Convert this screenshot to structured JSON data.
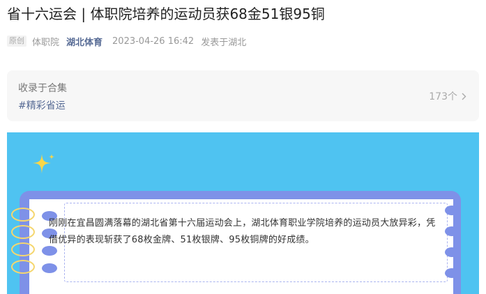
{
  "article": {
    "title": "省十六运会 | 体职院培养的运动员获68金51银95铜",
    "badge": "原创",
    "author": "体职院",
    "account": "湖北体育",
    "datetime": "2023-04-26 16:42",
    "location": "发表于湖北"
  },
  "collection": {
    "label": "收录于合集",
    "tag": "#精彩省运",
    "count": "173个"
  },
  "hero": {
    "text": "刚刚在宜昌圆满落幕的湖北省第十六届运动会上，湖北体育职业学院培养的运动员大放异彩，凭借优异的表现斩获了68枚金牌、51枚银牌、95枚铜牌的好成绩。"
  },
  "colors": {
    "hero_bg": "#4fc3f1",
    "note_frame": "#7e91e8",
    "link": "#576b95",
    "sparkle": "#f9d648"
  },
  "icons": [
    "sparkle-icon",
    "chevron-right-icon"
  ]
}
